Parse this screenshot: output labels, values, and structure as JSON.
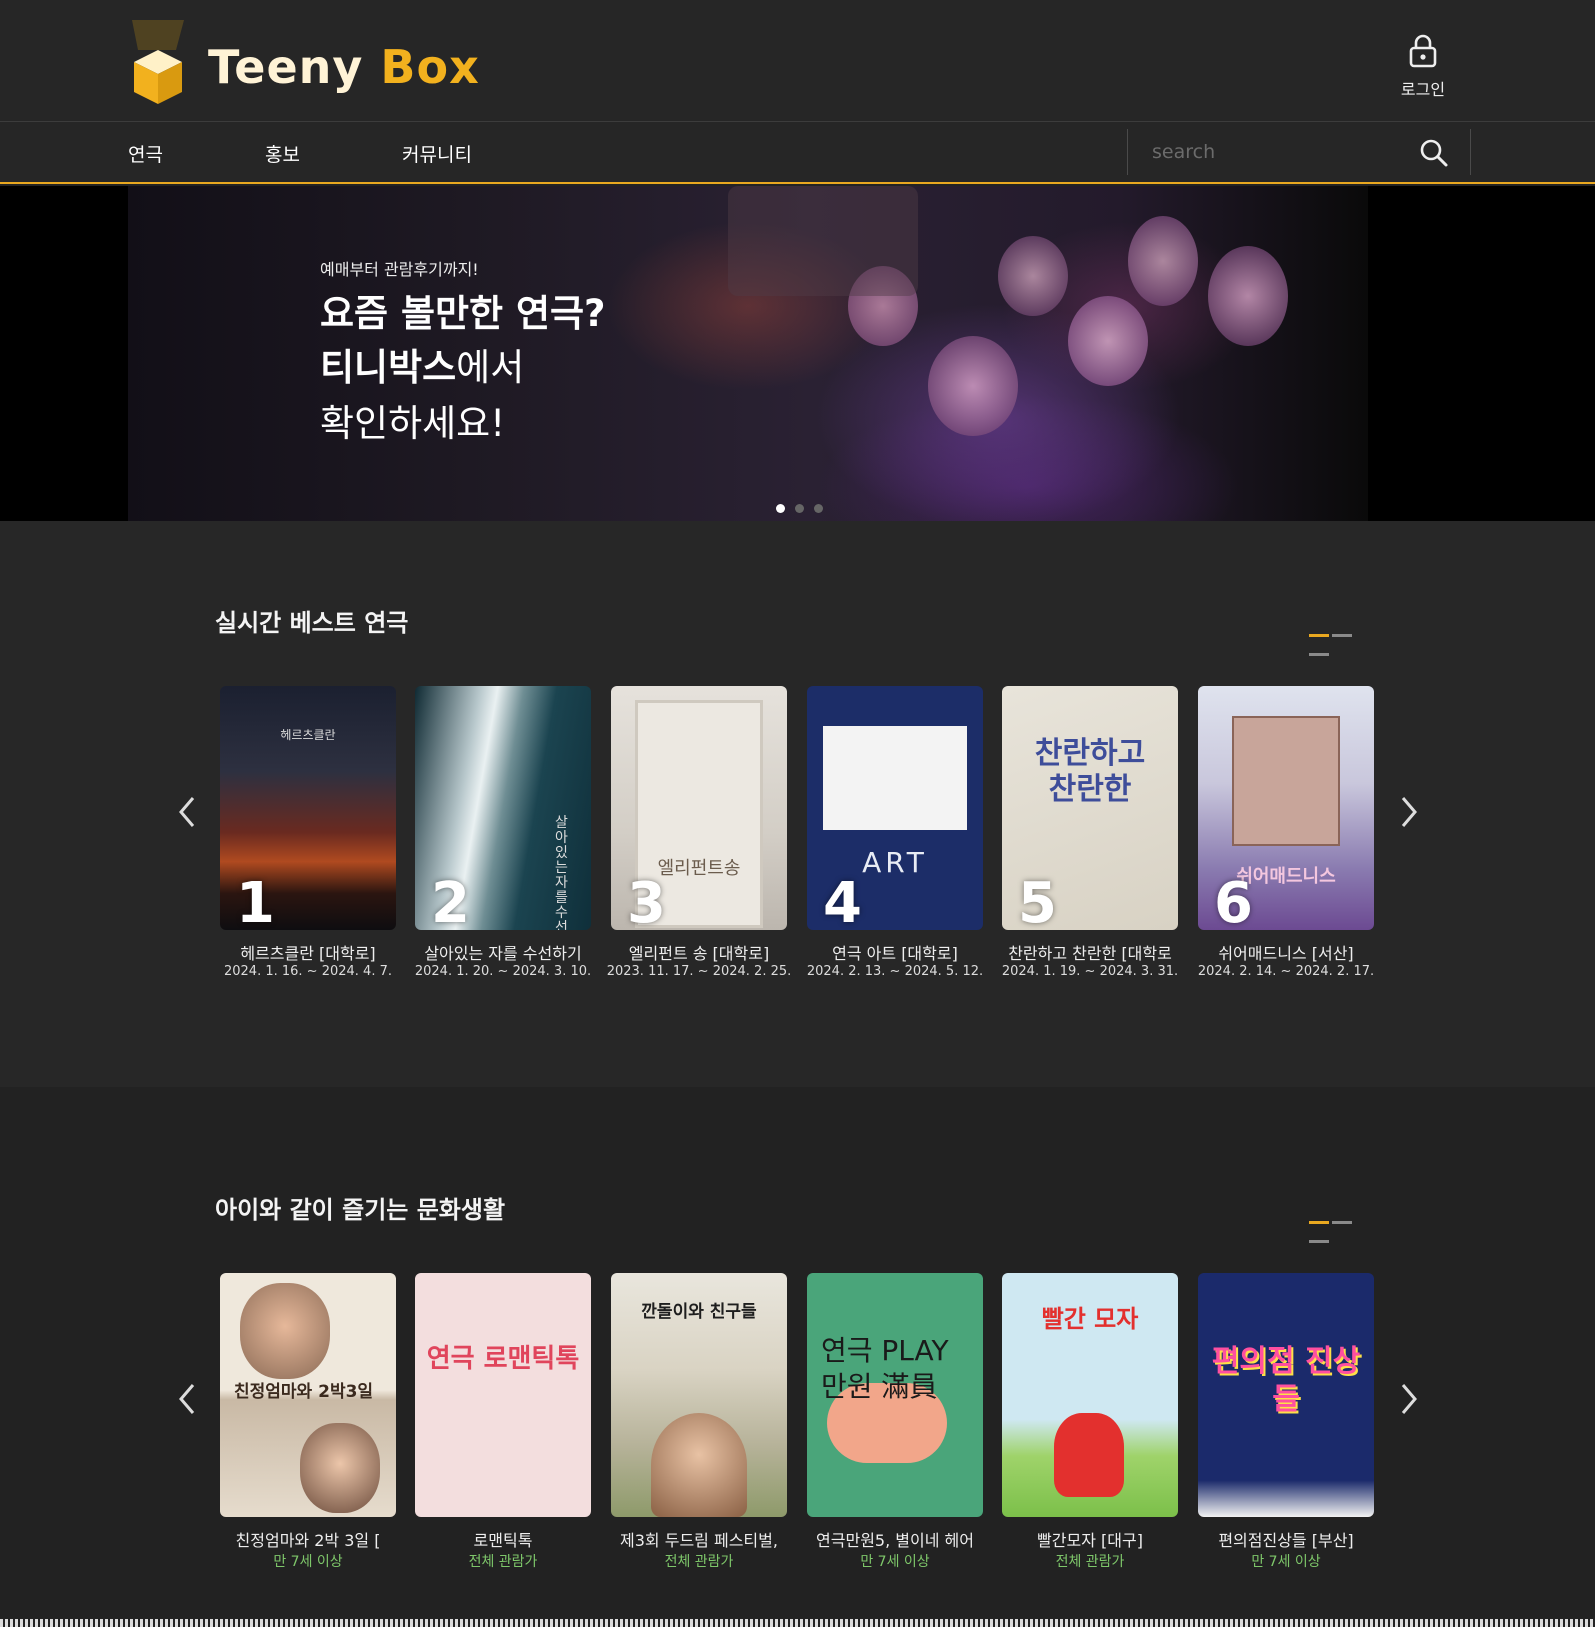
{
  "logo": {
    "word1": "Teeny",
    "word2": "Box"
  },
  "header": {
    "login_label": "로그인"
  },
  "nav": {
    "items": [
      {
        "label": "연극"
      },
      {
        "label": "홍보"
      },
      {
        "label": "커뮤니티"
      }
    ]
  },
  "search": {
    "placeholder": "search"
  },
  "hero": {
    "sub": "예매부터 관람후기까지!",
    "line1": "요즘 볼만한 연극?",
    "line2_bold": "티니박스",
    "line2_rest": "에서",
    "line3": "확인하세요!",
    "slides": 3,
    "active_slide": 1
  },
  "colors": {
    "accent": "#e9a820",
    "age_green": "#7ec76a",
    "bg": "#232323"
  },
  "best": {
    "title": "실시간 베스트 연극",
    "items": [
      {
        "rank": "1",
        "title": "헤르츠클란 [대학로]",
        "date": "2024. 1. 16. ~ 2024. 4. 7.",
        "poster_text": "헤르츠클란"
      },
      {
        "rank": "2",
        "title": "살아있는 자를 수선하기",
        "date": "2024. 1. 20. ~ 2024. 3. 10.",
        "poster_text": "살아있는 자를 수선하기"
      },
      {
        "rank": "3",
        "title": "엘리펀트 송 [대학로]",
        "date": "2023. 11. 17. ~ 2024. 2. 25.",
        "poster_text": "엘리펀트송"
      },
      {
        "rank": "4",
        "title": "연극 아트 [대학로]",
        "date": "2024. 2. 13. ~ 2024. 5. 12.",
        "poster_text": "ART"
      },
      {
        "rank": "5",
        "title": "찬란하고 찬란한 [대학로",
        "date": "2024. 1. 19. ~ 2024. 3. 31.",
        "poster_text": "찬란하고 찬란한"
      },
      {
        "rank": "6",
        "title": "쉬어매드니스 [서산]",
        "date": "2024. 2. 14. ~ 2024. 2. 17.",
        "poster_text": "쉬어매드니스"
      }
    ]
  },
  "kids": {
    "title": "아이와 같이 즐기는 문화생활",
    "items": [
      {
        "title": "친정엄마와 2박 3일 [",
        "age": "만 7세 이상",
        "poster_text": "친정엄마와 2박3일"
      },
      {
        "title": "로맨틱톡",
        "age": "전체 관람가",
        "poster_text": "연극 로맨틱톡"
      },
      {
        "title": "제3회 두드림 페스티벌,",
        "age": "전체 관람가",
        "poster_text": "깐돌이와 친구들"
      },
      {
        "title": "연극만원5, 별이네 헤어",
        "age": "만 7세 이상",
        "poster_text": "연극 PLAY 만원 滿員"
      },
      {
        "title": "빨간모자 [대구]",
        "age": "전체 관람가",
        "poster_text": "빨간 모자"
      },
      {
        "title": "편의점진상들 [부산]",
        "age": "만 7세 이상",
        "poster_text": "편의점 진상들"
      }
    ]
  }
}
